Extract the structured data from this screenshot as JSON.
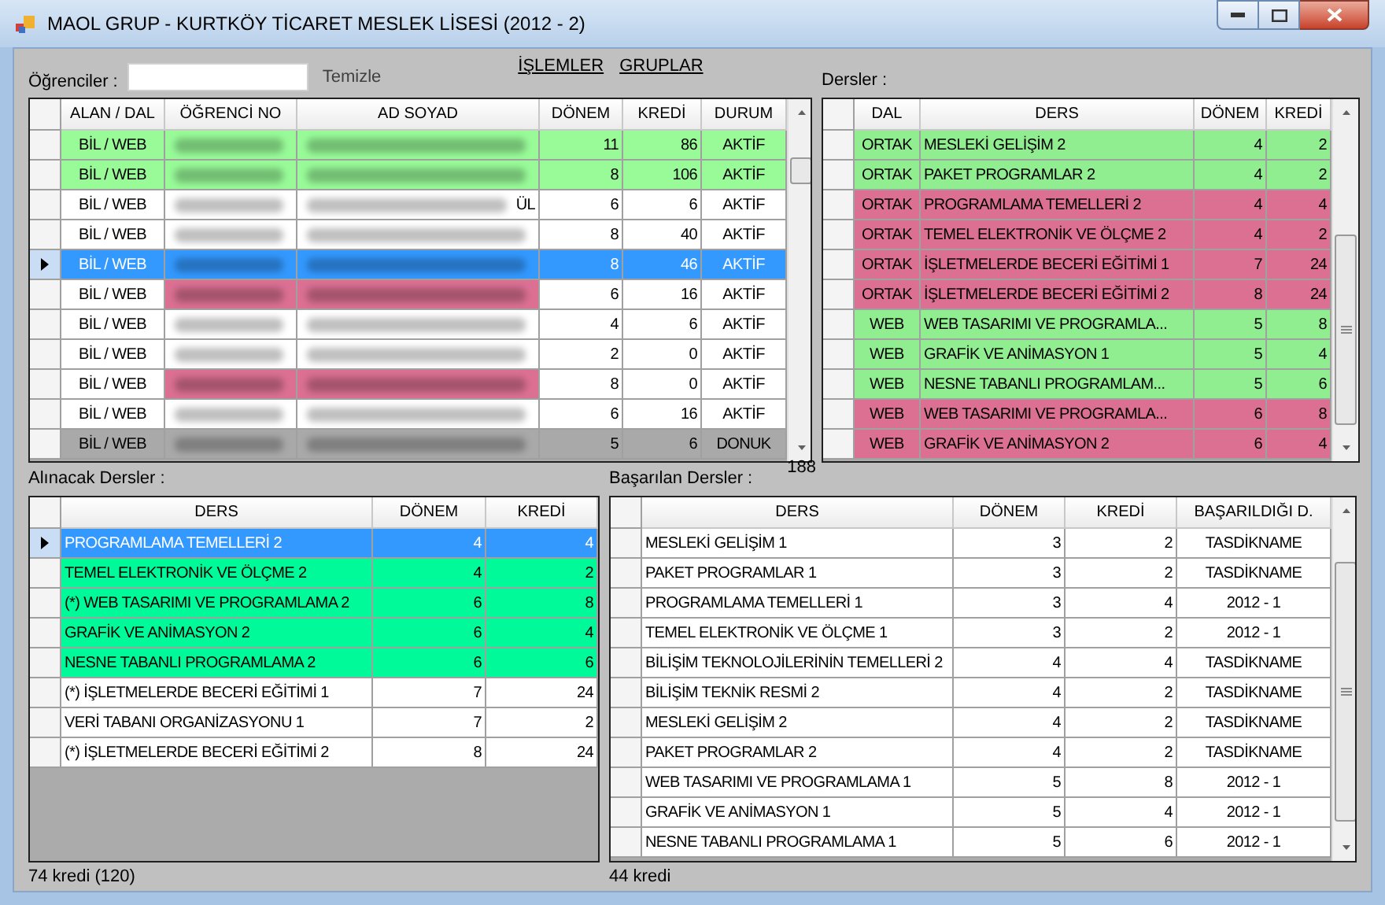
{
  "window": {
    "title": "MAOL GRUP - KURTKÖY TİCARET MESLEK LİSESİ (2012 - 2)"
  },
  "students": {
    "label": "Öğrenciler :",
    "clear_button": "Temizle",
    "columns": [
      "ALAN / DAL",
      "ÖĞRENCİ NO",
      "AD SOYAD",
      "DÖNEM",
      "KREDİ",
      "DURUM"
    ],
    "rows": [
      {
        "dal": "BİL / WEB",
        "donem": "11",
        "kredi": "86",
        "durum": "AKTİF",
        "kind": "passed",
        "flagged": false,
        "selected": false
      },
      {
        "dal": "BİL / WEB",
        "donem": "8",
        "kredi": "106",
        "durum": "AKTİF",
        "kind": "passed",
        "flagged": false,
        "selected": false
      },
      {
        "dal": "BİL / WEB",
        "name_tail": "ÜL",
        "donem": "6",
        "kredi": "6",
        "durum": "AKTİF",
        "kind": "normal",
        "flagged": false,
        "selected": false
      },
      {
        "dal": "BİL / WEB",
        "donem": "8",
        "kredi": "40",
        "durum": "AKTİF",
        "kind": "normal",
        "flagged": false,
        "selected": false
      },
      {
        "dal": "BİL / WEB",
        "donem": "8",
        "kredi": "46",
        "durum": "AKTİF",
        "kind": "normal",
        "flagged": false,
        "selected": true
      },
      {
        "dal": "BİL / WEB",
        "donem": "6",
        "kredi": "16",
        "durum": "AKTİF",
        "kind": "normal",
        "flagged": true,
        "selected": false
      },
      {
        "dal": "BİL / WEB",
        "donem": "4",
        "kredi": "6",
        "durum": "AKTİF",
        "kind": "normal",
        "flagged": false,
        "selected": false
      },
      {
        "dal": "BİL / WEB",
        "donem": "2",
        "kredi": "0",
        "durum": "AKTİF",
        "kind": "normal",
        "flagged": false,
        "selected": false
      },
      {
        "dal": "BİL / WEB",
        "donem": "8",
        "kredi": "0",
        "durum": "AKTİF",
        "kind": "normal",
        "flagged": true,
        "selected": false
      },
      {
        "dal": "BİL / WEB",
        "donem": "6",
        "kredi": "16",
        "durum": "AKTİF",
        "kind": "normal",
        "flagged": false,
        "selected": false
      },
      {
        "dal": "BİL / WEB",
        "donem": "5",
        "kredi": "6",
        "durum": "DONUK",
        "kind": "frozen",
        "flagged": false,
        "selected": false
      }
    ]
  },
  "menu": [
    "İŞLEMLER",
    "GRUPLAR"
  ],
  "courses": {
    "label": "Dersler :",
    "columns": [
      "DAL",
      "DERS",
      "DÖNEM",
      "KREDİ"
    ],
    "rows": [
      {
        "dal": "ORTAK",
        "ders": "MESLEKİ GELİŞİM 2",
        "donem": "4",
        "kredi": "2",
        "color": "#90ee90"
      },
      {
        "dal": "ORTAK",
        "ders": "PAKET PROGRAMLAR 2",
        "donem": "4",
        "kredi": "2",
        "color": "#90ee90"
      },
      {
        "dal": "ORTAK",
        "ders": "PROGRAMLAMA TEMELLERİ 2",
        "donem": "4",
        "kredi": "4",
        "color": "#db7093"
      },
      {
        "dal": "ORTAK",
        "ders": "TEMEL ELEKTRONİK VE ÖLÇME 2",
        "donem": "4",
        "kredi": "2",
        "color": "#db7093"
      },
      {
        "dal": "ORTAK",
        "ders": "İŞLETMELERDE BECERİ EĞİTİMİ 1",
        "donem": "7",
        "kredi": "24",
        "color": "#db7093"
      },
      {
        "dal": "ORTAK",
        "ders": "İŞLETMELERDE BECERİ EĞİTİMİ 2",
        "donem": "8",
        "kredi": "24",
        "color": "#db7093"
      },
      {
        "dal": "WEB",
        "ders": "WEB TASARIMI VE PROGRAMLA...",
        "donem": "5",
        "kredi": "8",
        "color": "#90ee90"
      },
      {
        "dal": "WEB",
        "ders": "GRAFİK VE ANİMASYON 1",
        "donem": "5",
        "kredi": "4",
        "color": "#90ee90"
      },
      {
        "dal": "WEB",
        "ders": "NESNE TABANLI PROGRAMLAM...",
        "donem": "5",
        "kredi": "6",
        "color": "#90ee90"
      },
      {
        "dal": "WEB",
        "ders": "WEB TASARIMI VE PROGRAMLA...",
        "donem": "6",
        "kredi": "8",
        "color": "#db7093"
      },
      {
        "dal": "WEB",
        "ders": "GRAFİK VE ANİMASYON 2",
        "donem": "6",
        "kredi": "4",
        "color": "#db7093"
      }
    ]
  },
  "to_take": {
    "label": "Alınacak Dersler :",
    "columns": [
      "DERS",
      "DÖNEM",
      "KREDİ"
    ],
    "rows": [
      {
        "ders": "PROGRAMLAMA TEMELLERİ 2",
        "donem": "4",
        "kredi": "4",
        "selected": true
      },
      {
        "ders": "TEMEL ELEKTRONİK VE ÖLÇME 2",
        "donem": "4",
        "kredi": "2",
        "selected": false,
        "color": "#00fa9a"
      },
      {
        "ders": "(*) WEB TASARIMI VE PROGRAMLAMA 2",
        "donem": "6",
        "kredi": "8",
        "selected": false,
        "color": "#00fa9a"
      },
      {
        "ders": "GRAFİK VE ANİMASYON 2",
        "donem": "6",
        "kredi": "4",
        "selected": false,
        "color": "#00fa9a"
      },
      {
        "ders": "NESNE TABANLI PROGRAMLAMA 2",
        "donem": "6",
        "kredi": "6",
        "selected": false,
        "color": "#00fa9a"
      },
      {
        "ders": "(*) İŞLETMELERDE BECERİ EĞİTİMİ 1",
        "donem": "7",
        "kredi": "24",
        "selected": false,
        "color": "#ffffff"
      },
      {
        "ders": "VERİ TABANI ORGANİZASYONU 1",
        "donem": "7",
        "kredi": "2",
        "selected": false,
        "color": "#ffffff"
      },
      {
        "ders": "(*) İŞLETMELERDE BECERİ EĞİTİMİ 2",
        "donem": "8",
        "kredi": "24",
        "selected": false,
        "color": "#ffffff"
      }
    ],
    "total": "74 kredi (120)"
  },
  "passed": {
    "label": "Başarılan Dersler :",
    "count": "188",
    "columns": [
      "DERS",
      "DÖNEM",
      "KREDİ",
      "BAŞARILDIĞI D."
    ],
    "rows": [
      {
        "ders": "MESLEKİ GELİŞİM 1",
        "donem": "3",
        "kredi": "2",
        "when": "TASDİKNAME"
      },
      {
        "ders": "PAKET PROGRAMLAR 1",
        "donem": "3",
        "kredi": "2",
        "when": "TASDİKNAME"
      },
      {
        "ders": "PROGRAMLAMA TEMELLERİ 1",
        "donem": "3",
        "kredi": "4",
        "when": "2012 - 1"
      },
      {
        "ders": "TEMEL ELEKTRONİK VE ÖLÇME 1",
        "donem": "3",
        "kredi": "2",
        "when": "2012 - 1"
      },
      {
        "ders": "BİLİŞİM TEKNOLOJİLERİNİN TEMELLERİ 2",
        "donem": "4",
        "kredi": "4",
        "when": "TASDİKNAME"
      },
      {
        "ders": "BİLİŞİM TEKNİK RESMİ 2",
        "donem": "4",
        "kredi": "2",
        "when": "TASDİKNAME"
      },
      {
        "ders": "MESLEKİ GELİŞİM 2",
        "donem": "4",
        "kredi": "2",
        "when": "TASDİKNAME"
      },
      {
        "ders": "PAKET PROGRAMLAR 2",
        "donem": "4",
        "kredi": "2",
        "when": "TASDİKNAME"
      },
      {
        "ders": "WEB TASARIMI VE PROGRAMLAMA 1",
        "donem": "5",
        "kredi": "8",
        "when": "2012 - 1"
      },
      {
        "ders": "GRAFİK VE ANİMASYON 1",
        "donem": "5",
        "kredi": "4",
        "when": "2012 - 1"
      },
      {
        "ders": "NESNE TABANLI PROGRAMLAMA 1",
        "donem": "5",
        "kredi": "6",
        "when": "2012 - 1"
      }
    ],
    "total": "44 kredi"
  }
}
